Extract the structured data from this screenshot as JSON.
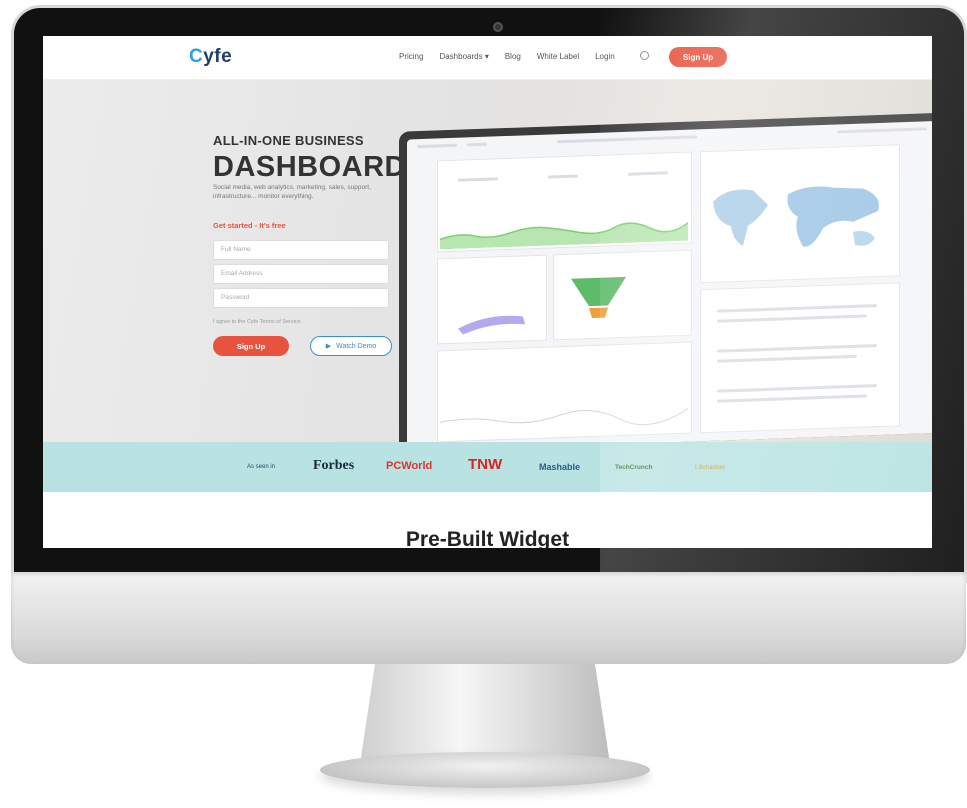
{
  "brand": {
    "logo_first": "C",
    "logo_rest": "yfe"
  },
  "nav": {
    "items": [
      "Pricing",
      "Dashboards ▾",
      "Blog",
      "White Label",
      "Login"
    ],
    "signup_label": "Sign Up"
  },
  "hero": {
    "title_small": "ALL-IN-ONE BUSINESS",
    "title_big": "DASHBOARD",
    "subtitle": "Social media, web analytics, marketing, sales, support, infrastructure... monitor everything.",
    "cta_text": "Get started - It's free",
    "fields": [
      {
        "placeholder": "Full Name"
      },
      {
        "placeholder": "Email Address"
      },
      {
        "placeholder": "Password"
      }
    ],
    "terms_text": "I agree to the Cyfe Terms of Service",
    "signup_button": "Sign Up",
    "tour_button": "Watch Demo"
  },
  "press": {
    "logos": [
      "As seen in",
      "Forbes",
      "PCWorld",
      "TNW",
      "Mashable",
      "TechCrunch",
      "Lifehacker"
    ]
  },
  "section": {
    "heading": "Pre-Built Widget"
  },
  "colors": {
    "accent": "#e8533f",
    "press_strip": "#b8e3e2",
    "brand": "#1e3f66"
  }
}
